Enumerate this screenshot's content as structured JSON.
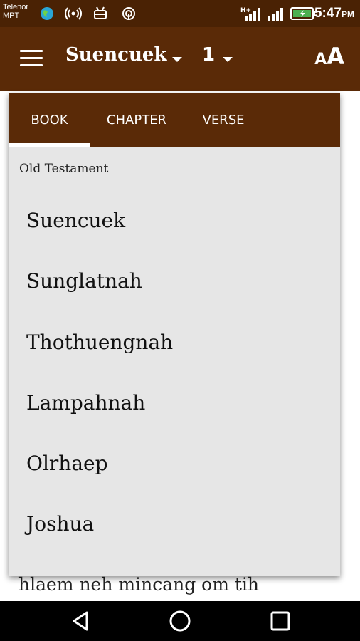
{
  "status_bar": {
    "carrier_line1": "Telenor",
    "carrier_line2": "MPT",
    "time": "5:47",
    "time_suffix": "PM",
    "network_label": "H+"
  },
  "app_bar": {
    "book": "Suencuek",
    "chapter": "1"
  },
  "popup": {
    "tabs": [
      "BOOK",
      "CHAPTER",
      "VERSE"
    ],
    "active_tab": "BOOK",
    "section": "Old Testament",
    "books": [
      "Suencuek",
      "Sunglatnah",
      "Thothuengnah",
      "Lampahnah",
      "Olrhaep",
      "Joshua"
    ]
  },
  "background": {
    "visible_line": "hlaem neh mincang om tih"
  },
  "colors": {
    "primary": "#5a2a07",
    "status_bar": "#4a2204",
    "popup_bg": "#e6e6e6"
  }
}
